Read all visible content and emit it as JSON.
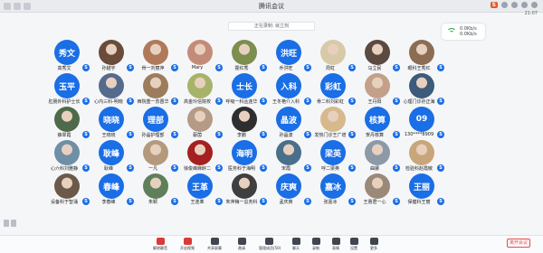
{
  "window": {
    "title": "腾讯会议",
    "time": "21:07"
  },
  "titlebar_tools": {
    "logo": "S"
  },
  "banner": "正在录制: 就立刻",
  "signal": {
    "line1": "0.0Kb/s",
    "line2": "0.0Kb/s"
  },
  "participants": [
    {
      "name": "高秀文",
      "avatar_text": "秀文",
      "type": "text"
    },
    {
      "name": "孙越宇",
      "avatar_text": "",
      "type": "photo",
      "color": "#6b4b3a"
    },
    {
      "name": "骨一刘丽萍",
      "avatar_text": "",
      "type": "photo",
      "color": "#b07a5a"
    },
    {
      "name": "Mary",
      "avatar_text": "",
      "type": "photo",
      "color": "#c58b7a"
    },
    {
      "name": "霍红秀",
      "avatar_text": "",
      "type": "photo",
      "color": "#7c8f4e"
    },
    {
      "name": "乔洪旺",
      "avatar_text": "洪旺",
      "type": "text"
    },
    {
      "name": "周虹",
      "avatar_text": "",
      "type": "photo",
      "color": "#d8c9a8"
    },
    {
      "name": "马立民",
      "avatar_text": "",
      "type": "photo",
      "color": "#5a4a3f"
    },
    {
      "name": "眼科王秀红",
      "avatar_text": "",
      "type": "photo",
      "color": "#8a6d52"
    },
    {
      "name": "",
      "avatar_text": "",
      "type": "empty"
    },
    {
      "name": "肛肠外科护士长",
      "avatar_text": "玉平",
      "type": "text"
    },
    {
      "name": "心内三科-明晓",
      "avatar_text": "",
      "type": "photo",
      "color": "#556b8d"
    },
    {
      "name": "西院重一苏晋华",
      "avatar_text": "",
      "type": "photo",
      "color": "#9c7c5b"
    },
    {
      "name": "高金玲信院校",
      "avatar_text": "",
      "type": "photo",
      "color": "#a8b36a"
    },
    {
      "name": "呼吸一科丛连华",
      "avatar_text": "士长",
      "type": "text"
    },
    {
      "name": "王冬艳介入科",
      "avatar_text": "入科",
      "type": "text"
    },
    {
      "name": "骨二科刘彩虹",
      "avatar_text": "彩虹",
      "type": "text"
    },
    {
      "name": "王丹阳",
      "avatar_text": "",
      "type": "photo",
      "color": "#c2a08a"
    },
    {
      "name": "心理门诊孙正海",
      "avatar_text": "",
      "type": "photo",
      "color": "#3d5b7a"
    },
    {
      "name": "",
      "avatar_text": "",
      "type": "empty"
    },
    {
      "name": "薛翠霞",
      "avatar_text": "",
      "type": "photo",
      "color": "#4f6a4a"
    },
    {
      "name": "王晓晓",
      "avatar_text": "晓晓",
      "type": "text"
    },
    {
      "name": "孙晶护理部",
      "avatar_text": "理部",
      "type": "text"
    },
    {
      "name": "蔡茵",
      "avatar_text": "",
      "type": "photo",
      "color": "#b59b86"
    },
    {
      "name": "李鹏",
      "avatar_text": "",
      "type": "photo",
      "color": "#2e2e2e"
    },
    {
      "name": "孙晶波",
      "avatar_text": "晶波",
      "type": "text"
    },
    {
      "name": "发热门诊王广增",
      "avatar_text": "",
      "type": "photo",
      "color": "#d6b98c"
    },
    {
      "name": "贺丹核算",
      "avatar_text": "核算",
      "type": "text"
    },
    {
      "name": "130****8909",
      "avatar_text": "09",
      "type": "text"
    },
    {
      "name": "",
      "avatar_text": "",
      "type": "empty"
    },
    {
      "name": "心六科刘雅静",
      "avatar_text": "",
      "type": "photo",
      "color": "#6e8fa6"
    },
    {
      "name": "耿峰",
      "avatar_text": "耿峰",
      "type": "text"
    },
    {
      "name": "一凡",
      "avatar_text": "",
      "type": "photo",
      "color": "#b39a7c"
    },
    {
      "name": "徐俊峰麻醉二",
      "avatar_text": "",
      "type": "photo",
      "color": "#a52020"
    },
    {
      "name": "医务科于海明",
      "avatar_text": "海明",
      "type": "text"
    },
    {
      "name": "宋霞",
      "avatar_text": "",
      "type": "photo",
      "color": "#4a6f8a"
    },
    {
      "name": "呼二梁英",
      "avatar_text": "梁英",
      "type": "text"
    },
    {
      "name": "曲娜",
      "avatar_text": "",
      "type": "photo",
      "color": "#8c9aa7"
    },
    {
      "name": "检验科赵霞敏",
      "avatar_text": "",
      "type": "photo",
      "color": "#c9a67a"
    },
    {
      "name": "",
      "avatar_text": "",
      "type": "empty"
    },
    {
      "name": "设备科于智涌",
      "avatar_text": "",
      "type": "photo",
      "color": "#6b5a4a"
    },
    {
      "name": "李春峰",
      "avatar_text": "春峰",
      "type": "text"
    },
    {
      "name": "朱颖",
      "avatar_text": "",
      "type": "photo",
      "color": "#5f7f5a"
    },
    {
      "name": "王连革",
      "avatar_text": "王革",
      "type": "text"
    },
    {
      "name": "朱萍梅一总务科",
      "avatar_text": "",
      "type": "photo",
      "color": "#3f3f3f"
    },
    {
      "name": "孟庆爽",
      "avatar_text": "庆爽",
      "type": "text"
    },
    {
      "name": "张嘉冰",
      "avatar_text": "嘉冰",
      "type": "text"
    },
    {
      "name": "王惠君一心",
      "avatar_text": "",
      "type": "photo",
      "color": "#9a8878"
    },
    {
      "name": "保健科王丽",
      "avatar_text": "王丽",
      "type": "text"
    },
    {
      "name": "",
      "avatar_text": "",
      "type": "empty"
    }
  ],
  "badge_label": "S",
  "toolbar": [
    {
      "label": "解除静音"
    },
    {
      "label": "开启视频"
    },
    {
      "label": "共享屏幕"
    },
    {
      "label": "邀请"
    },
    {
      "label": "管理成员(50)"
    },
    {
      "label": "聊天"
    },
    {
      "label": "录制"
    },
    {
      "label": "表情"
    },
    {
      "label": "设置"
    },
    {
      "label": "更多"
    }
  ],
  "end_button": "离开会议"
}
